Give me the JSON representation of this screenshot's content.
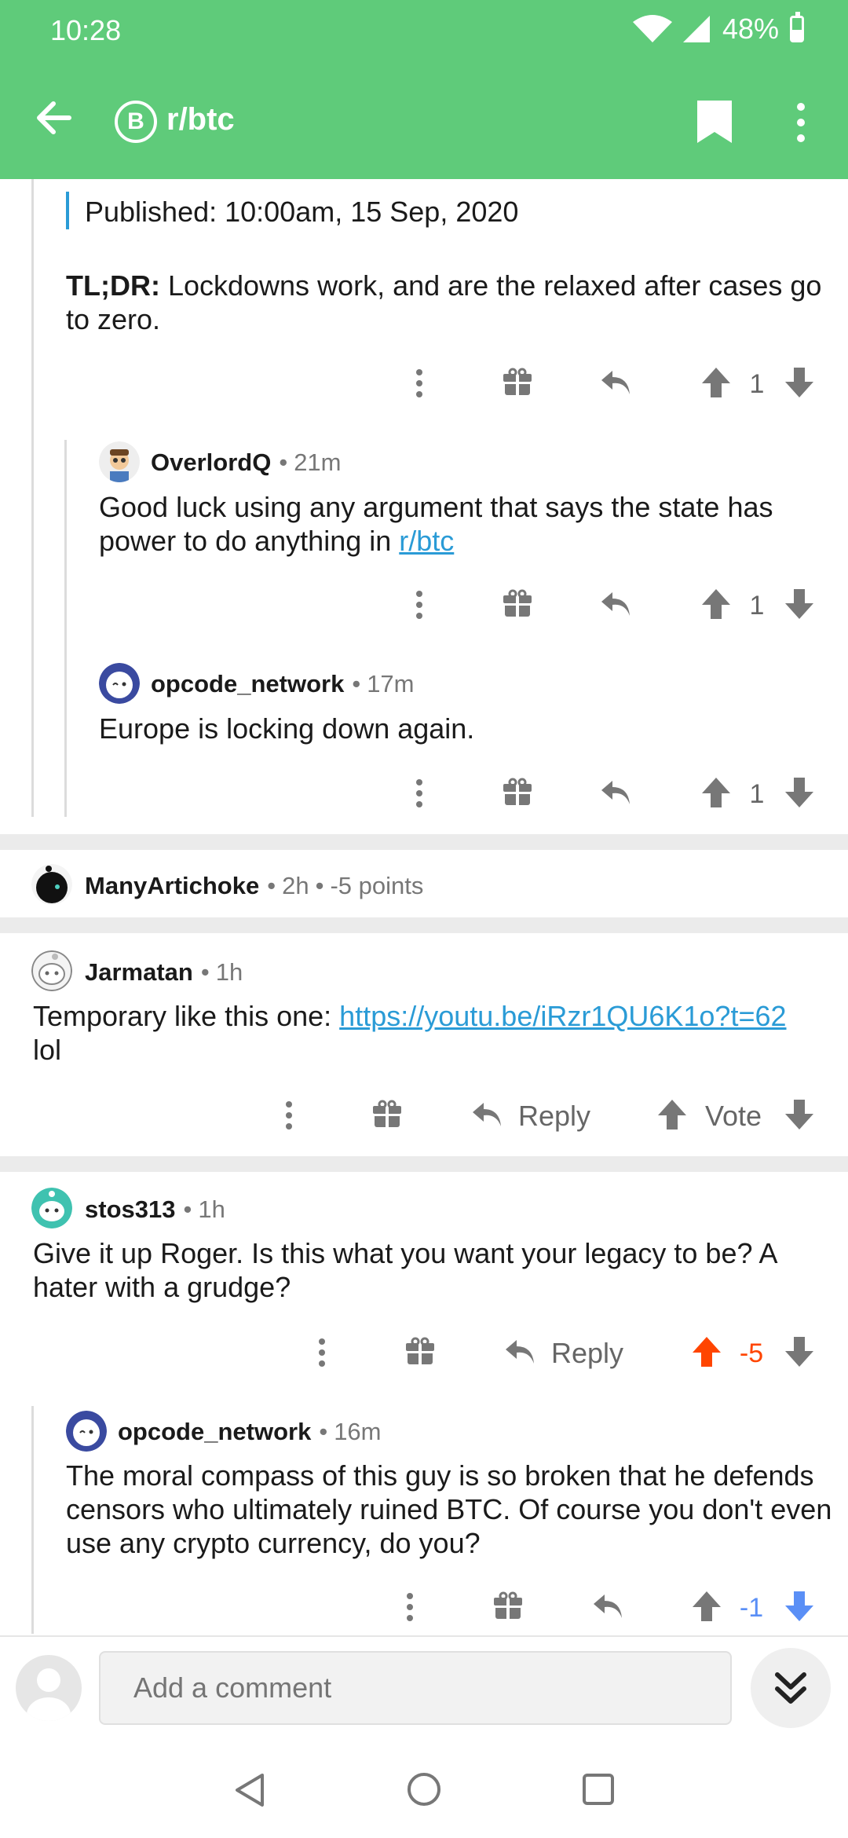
{
  "status_bar": {
    "time": "10:28",
    "battery": "48%"
  },
  "app_bar": {
    "subreddit": "r/btc",
    "subreddit_icon": "B"
  },
  "colors": {
    "accent": "#5fcb7a",
    "link": "#2a9bd6",
    "upvote_active": "#ff4500",
    "downvote_active": "#5a8ff6"
  },
  "top_comment": {
    "quote": "Published: 10:00am, 15 Sep, 2020",
    "tldr_label": "TL;DR:",
    "tldr_text": " Lockdowns work, and are the relaxed after cases go to zero.",
    "score": "1"
  },
  "reply_overlord": {
    "author": "OverlordQ",
    "time": "21m",
    "body_before_link": "Good luck using any argument that says the state has power to do anything in ",
    "link": "r/btc",
    "score": "1"
  },
  "reply_opcode_1": {
    "author": "opcode_network",
    "time": "17m",
    "body": "Europe is locking down again.",
    "score": "1"
  },
  "collapsed_comment": {
    "author": "ManyArtichoke",
    "time": "2h",
    "points": "-5 points"
  },
  "comment_jarmatan": {
    "author": "Jarmatan",
    "time": "1h",
    "body_before_link": "Temporary like this one: ",
    "link": "https://youtu.be/iRzr1QU6K1o?t=62",
    "body_after_link": "lol",
    "reply_label": "Reply",
    "vote_label": "Vote"
  },
  "comment_stos": {
    "author": "stos313",
    "time": "1h",
    "body": "Give it up Roger. Is this what you want your legacy to be?  A hater with a grudge?",
    "reply_label": "Reply",
    "score": "-5"
  },
  "reply_opcode_2": {
    "author": "opcode_network",
    "time": "16m",
    "body": "The moral compass of this guy is so broken that he defends censors who ultimately ruined BTC. Of course you don't even use any crypto currency, do you?",
    "score": "-1"
  },
  "compose": {
    "placeholder": "Add a comment"
  },
  "separator": "•"
}
